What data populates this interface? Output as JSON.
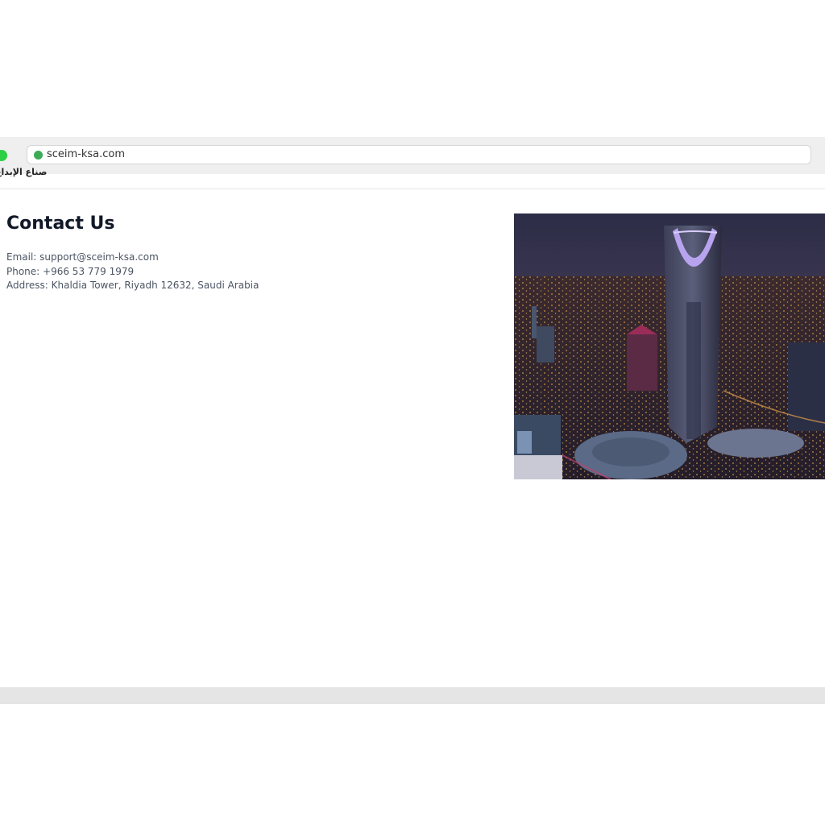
{
  "browser": {
    "url": "sceim-ksa.com"
  },
  "logo": {
    "text": "ﺻﻨﺎع اﻹﺑﺪاع"
  },
  "contact": {
    "title": "Contact Us",
    "email": "Email: support@sceim-ksa.com",
    "phone": "Phone: +966 53 779 1979",
    "address": "Address: Khaldia Tower, Riyadh 12632, Saudi Arabia"
  },
  "colors": {
    "title": "#111827",
    "body_text": "#4b5563",
    "window_green": "#2fcf44",
    "secure_green": "#3cab55",
    "chrome_bar": "#efefef"
  },
  "icons": {
    "window_control": "green-dot",
    "secure": "secure-dot"
  }
}
